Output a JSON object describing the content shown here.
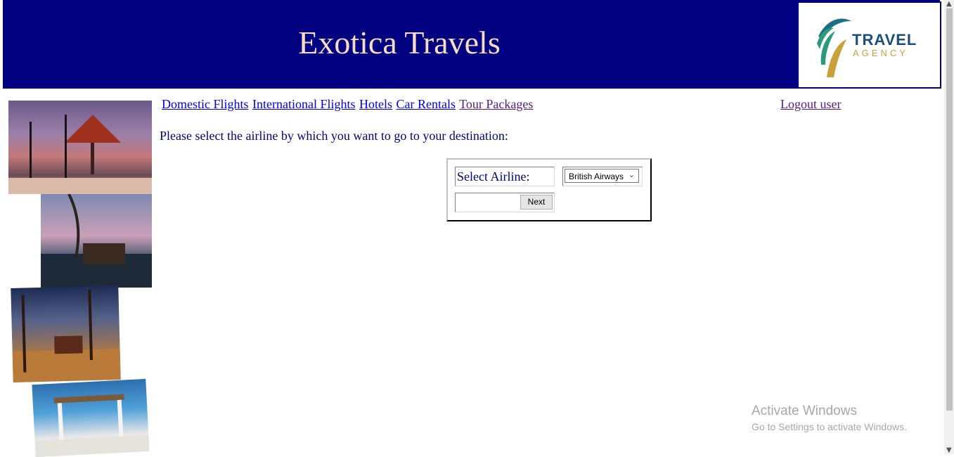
{
  "header": {
    "title": "Exotica Travels",
    "logo_line1": "TRAVEL",
    "logo_line2": "AGENCY",
    "background": "#000080",
    "title_color": "#f5dcc3"
  },
  "nav": {
    "links": [
      "Domestic Flights",
      "International Flights",
      "Hotels",
      "Car Rentals",
      "Tour Packages"
    ],
    "logout": "Logout user"
  },
  "main": {
    "prompt": "Please select the airline by which you want to go to your destination:",
    "airline_label": "Select Airline:",
    "airline_selected": "British Airways",
    "next_button": "Next"
  },
  "watermark": {
    "line1": "Activate Windows",
    "line2": "Go to Settings to activate Windows."
  },
  "side_images": [
    "beach-hut-photo",
    "beach-dinner-photo",
    "candlelit-beach-photo",
    "beach-wedding-photo"
  ]
}
